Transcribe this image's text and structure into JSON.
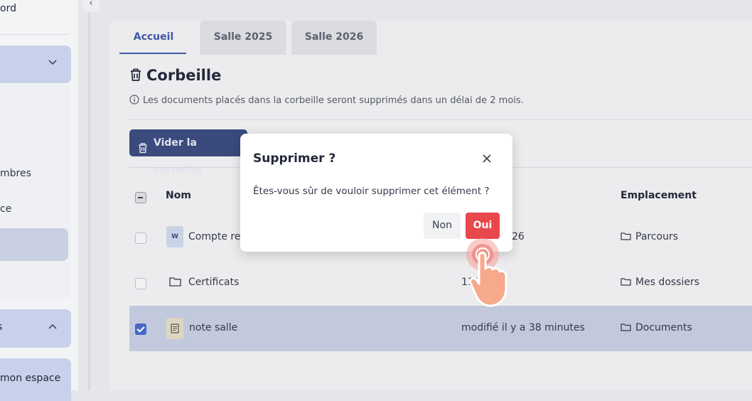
{
  "sidebar": {
    "title_fragment": "ord",
    "item_membres": "mbres",
    "item_espace": "ce",
    "section2_fragment": "s",
    "bottom_item": "mon espace"
  },
  "tabs": [
    {
      "label": "Accueil",
      "active": true
    },
    {
      "label": "Salle 2025",
      "active": false
    },
    {
      "label": "Salle 2026",
      "active": false
    }
  ],
  "page": {
    "title": "Corbeille",
    "info": "Les documents placés dans la corbeille seront supprimés dans un délai de 2 mois.",
    "empty_button": "Vider la corbeille"
  },
  "table": {
    "columns": {
      "name": "Nom",
      "location": "Emplacement"
    },
    "rows": [
      {
        "icon": "word-icon",
        "name": "Compte re",
        "modified": "26",
        "location": "Parcours",
        "selected": false
      },
      {
        "icon": "folder-icon",
        "name": "Certificats",
        "modified": "11/",
        "location": "Mes dossiers",
        "selected": false
      },
      {
        "icon": "note-icon",
        "name": "note salle",
        "modified": "modifié il y a 38 minutes",
        "location": "Documents",
        "selected": true
      }
    ],
    "word_badge": "W"
  },
  "modal": {
    "title": "Supprimer ?",
    "message": "Êtes-vous sûr de vouloir supprimer cet élément ?",
    "cancel_label": "Non",
    "confirm_label": "Oui"
  },
  "colors": {
    "accent": "#3f58a4",
    "primary_button": "#3a4a7c",
    "danger": "#e8474b",
    "checkbox": "#4767c8",
    "selected_row": "#c2c9dd"
  }
}
